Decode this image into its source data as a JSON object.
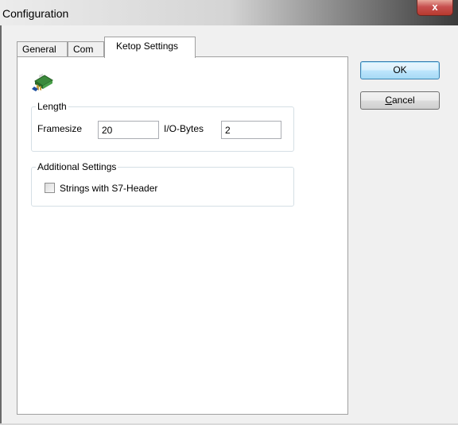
{
  "window": {
    "title": "Configuration",
    "close_glyph": "x"
  },
  "tabs": [
    {
      "label": "General",
      "active": false
    },
    {
      "label": "Com",
      "active": false
    },
    {
      "label": "Ketop Settings",
      "active": true
    }
  ],
  "panel": {
    "icon": "network-card-icon",
    "length_group": {
      "legend": "Length",
      "framesize_label": "Framesize",
      "framesize_value": "20",
      "io_bytes_label": "I/O-Bytes",
      "io_bytes_value": "2"
    },
    "additional_group": {
      "legend": "Additional Settings",
      "strings_checkbox_label": "Strings with S7-Header",
      "strings_checked": false
    }
  },
  "buttons": {
    "ok_label": "OK",
    "cancel_label": "Cancel"
  },
  "colors": {
    "default_button_border": "#3c7fb1",
    "close_button": "#c75050"
  }
}
